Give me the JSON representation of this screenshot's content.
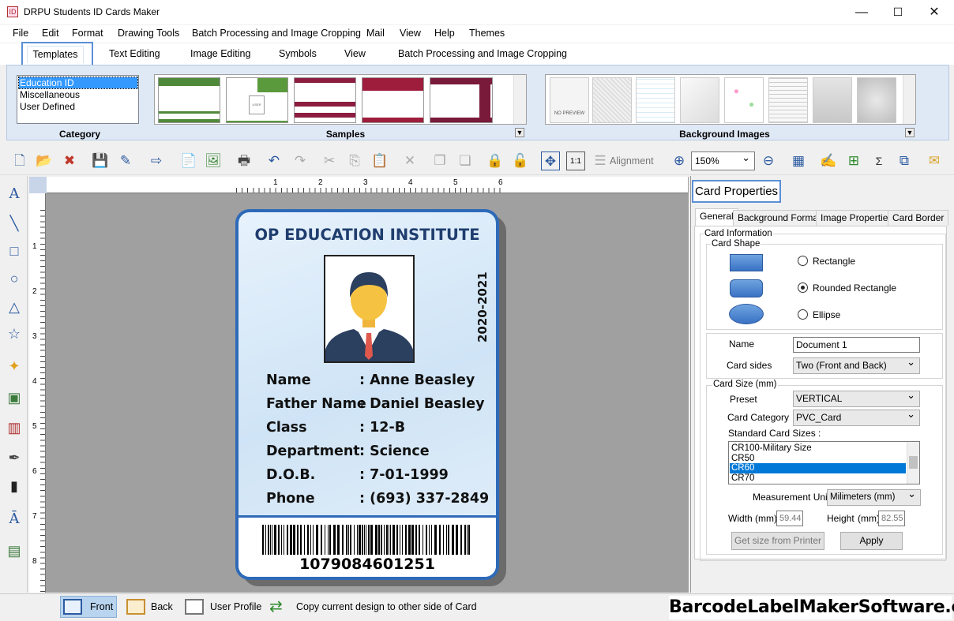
{
  "window": {
    "title": "DRPU Students ID Cards Maker",
    "minimize": "—",
    "maximize": "☐",
    "close": "✕"
  },
  "menu": [
    "File",
    "Edit",
    "Format",
    "Drawing Tools",
    "Batch Processing and Image Cropping",
    "Mail",
    "View",
    "Help",
    "Themes"
  ],
  "ribbon_tabs": [
    "Templates",
    "Text Editing",
    "Image Editing",
    "Symbols",
    "View",
    "Batch Processing and Image Cropping"
  ],
  "ribbon": {
    "category_label": "Category",
    "categories": [
      "Education ID",
      "Miscellaneous",
      "User Defined"
    ],
    "samples_label": "Samples",
    "sample_photo_text": "USER PHOTO",
    "background_label": "Background Images",
    "no_preview": "NO PREVIEW"
  },
  "toolbar": {
    "alignment_label": "Alignment",
    "zoom_value": "150%",
    "actual_size": "1:1"
  },
  "rulers": {
    "top": [
      "1",
      "2",
      "3",
      "4",
      "5",
      "6"
    ],
    "left": [
      "1",
      "2",
      "3",
      "4",
      "5",
      "6",
      "7",
      "8"
    ]
  },
  "card": {
    "institute": "OP EDUCATION INSTITUTE",
    "year": "2020-2021",
    "fields": [
      {
        "label": "Name",
        "value": ": Anne Beasley"
      },
      {
        "label": "Father Name",
        "value": ": Daniel Beasley"
      },
      {
        "label": "Class",
        "value": ": 12-B"
      },
      {
        "label": "Department",
        "value": ": Science"
      },
      {
        "label": "D.O.B.",
        "value": ": 7-01-1999"
      },
      {
        "label": "Phone",
        "value": ": (693) 337-2849"
      }
    ],
    "barcode_number": "1079084601251"
  },
  "properties": {
    "title": "Card Properties",
    "tabs": [
      "General",
      "Background Format",
      "Image Properties",
      "Card Border"
    ],
    "card_information": "Card Information",
    "card_shape": "Card Shape",
    "shapes": [
      "Rectangle",
      "Rounded Rectangle",
      "Ellipse"
    ],
    "selected_shape": "Rounded Rectangle",
    "name_label": "Name",
    "name_value": "Document 1",
    "card_sides_label": "Card sides",
    "card_sides_value": "Two (Front and Back)",
    "card_size_label": "Card Size (mm)",
    "preset_label": "Preset",
    "preset_value": "VERTICAL",
    "card_category_label": "Card Category",
    "card_category_value": "PVC_Card",
    "standard_sizes_label": "Standard Card Sizes :",
    "standard_sizes": [
      "CR100-Military Size",
      "CR50",
      "CR60",
      "CR70"
    ],
    "selected_size": "CR60",
    "measurement_label": "Measurement Unit :",
    "measurement_value": "Milimeters (mm)",
    "width_label": "Width  (mm)",
    "width_value": "59.44",
    "height_label": "Height",
    "height_unit": "(mm)",
    "height_value": "82.55",
    "get_size_button": "Get size from Printer",
    "apply_button": "Apply"
  },
  "statusbar": {
    "front": "Front",
    "back": "Back",
    "user_profile": "User Profile",
    "copy_design": "Copy current design to other side of Card",
    "brand": "BarcodeLabelMakerSoftware.com"
  },
  "colors": {
    "accent": "#2e6ab8",
    "selection": "#0078d7",
    "title_text": "#1f3d6e"
  }
}
